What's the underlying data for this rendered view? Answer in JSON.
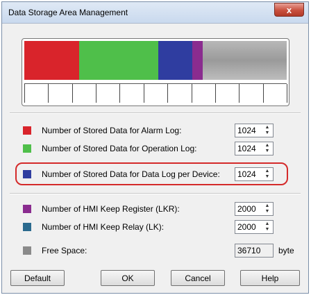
{
  "window": {
    "title": "Data Storage Area Management",
    "close_label": "x"
  },
  "storage_bar": {
    "segments": [
      {
        "name": "alarm-log",
        "color": "#d9242b",
        "fraction": 0.21
      },
      {
        "name": "operation-log",
        "color": "#4fbf4a",
        "fraction": 0.3
      },
      {
        "name": "data-log",
        "color": "#2f3da0",
        "fraction": 0.13
      },
      {
        "name": "hmi-keep-register",
        "color": "#8a2c8f",
        "fraction": 0.04
      },
      {
        "name": "free-space",
        "color": "#9a9a9a",
        "fraction": 0.32
      }
    ],
    "tick_count": 12
  },
  "settings": {
    "alarm_log": {
      "label": "Number of Stored Data for Alarm Log:",
      "value": "1024",
      "color": "#d9242b"
    },
    "operation_log": {
      "label": "Number of Stored Data for Operation Log:",
      "value": "1024",
      "color": "#4fbf4a"
    },
    "data_log": {
      "label": "Number of Stored Data for Data Log per Device:",
      "value": "1024",
      "color": "#2f3da0"
    },
    "keep_register": {
      "label": "Number of HMI Keep Register (LKR):",
      "value": "2000",
      "color": "#8a2c8f"
    },
    "keep_relay": {
      "label": "Number of HMI Keep Relay (LK):",
      "value": "2000",
      "color": "#2b6a8e"
    },
    "free_space": {
      "label": "Free Space:",
      "value": "36710",
      "unit": "byte",
      "color": "#8a8a8a"
    }
  },
  "buttons": {
    "default": "Default",
    "ok": "OK",
    "cancel": "Cancel",
    "help": "Help"
  }
}
